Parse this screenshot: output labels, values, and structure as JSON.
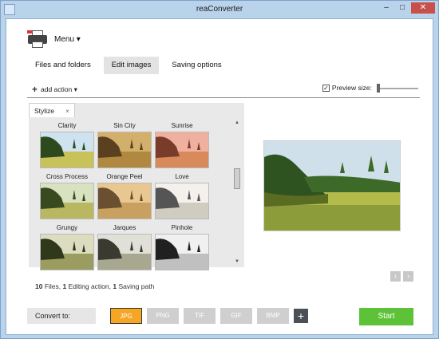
{
  "window": {
    "title": "reaConverter",
    "controls": [
      "–",
      "□",
      "✕"
    ]
  },
  "menu": {
    "label": "Menu ▾",
    "icon": "printer-icon"
  },
  "tabs": [
    {
      "label": "Files and folders",
      "active": false
    },
    {
      "label": "Edit images",
      "active": true
    },
    {
      "label": "Saving options",
      "active": false
    }
  ],
  "action_bar": {
    "add_action": "add action ▾",
    "preview_checkbox": "✓",
    "preview_label": "Preview size:"
  },
  "effects_panel": {
    "tab_label": "Stylize",
    "tab_close": "×",
    "effects": [
      {
        "label": "Clarity",
        "style": "clarity"
      },
      {
        "label": "Sin City",
        "style": "sincity"
      },
      {
        "label": "Sunrise",
        "style": "sunrise"
      },
      {
        "label": "Cross Process",
        "style": "cross"
      },
      {
        "label": "Orange Peel",
        "style": "orange"
      },
      {
        "label": "Love",
        "style": "love"
      },
      {
        "label": "Grungy",
        "style": "grungy"
      },
      {
        "label": "Jarques",
        "style": "jarques"
      },
      {
        "label": "Pinhole",
        "style": "pinhole"
      }
    ],
    "scroll_up": "▲",
    "scroll_down": "▼"
  },
  "nav": {
    "prev": "‹",
    "next": "›"
  },
  "info": {
    "files_count": "10",
    "files_label": " Files, ",
    "editing_count": "1",
    "editing_label": " Editing action, ",
    "saving_count": "1",
    "saving_label": " Saving path"
  },
  "convert": {
    "label": "Convert to:",
    "formats": [
      {
        "label": "JPG",
        "active": true
      },
      {
        "label": "PNG",
        "active": false
      },
      {
        "label": "TIF",
        "active": false
      },
      {
        "label": "GIF",
        "active": false
      },
      {
        "label": "BMP",
        "active": false
      }
    ],
    "add_label": "+"
  },
  "start_button": "Start",
  "colors": {
    "accent_orange": "#f7a623",
    "start_green": "#5ec238",
    "panel_gray": "#e9e9e9"
  }
}
